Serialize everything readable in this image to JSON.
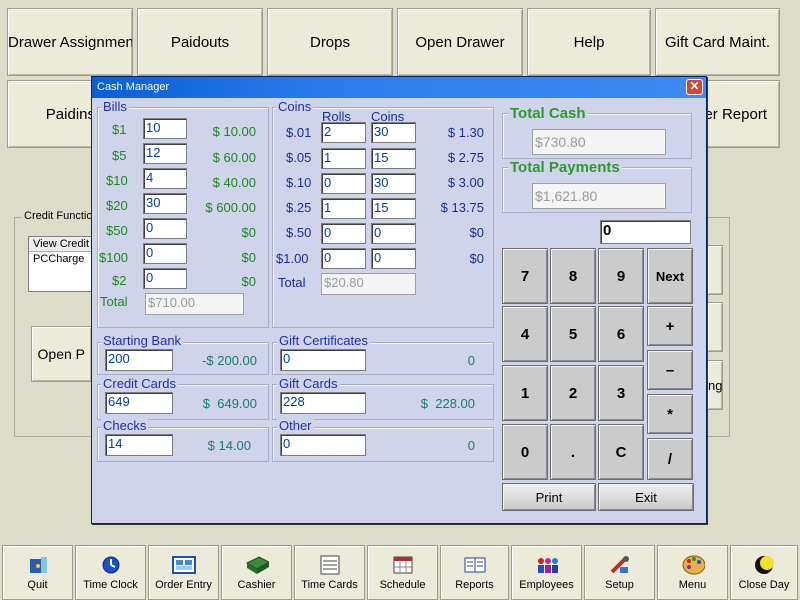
{
  "top_buttons": [
    "Drawer Assignment",
    "Paidouts",
    "Drops",
    "Open Drawer",
    "Help",
    "Gift Card Maint.",
    "Paidins",
    "er Report"
  ],
  "background": {
    "credit_functions_label": "Credit Function",
    "list_header": "View Credit S",
    "list_item": "PCCharge",
    "open_button": "Open P",
    "right_partial": "ng"
  },
  "dialog": {
    "title": "Cash Manager",
    "close_glyph": "✕",
    "bills": {
      "label": "Bills",
      "rows": [
        {
          "denom": "$1",
          "count": "10",
          "amount": "$ 10.00"
        },
        {
          "denom": "$5",
          "count": "12",
          "amount": "$ 60.00"
        },
        {
          "denom": "$10",
          "count": "4",
          "amount": "$ 40.00"
        },
        {
          "denom": "$20",
          "count": "30",
          "amount": "$ 600.00"
        },
        {
          "denom": "$50",
          "count": "0",
          "amount": "$0"
        },
        {
          "denom": "$100",
          "count": "0",
          "amount": "$0"
        },
        {
          "denom": "$2",
          "count": "0",
          "amount": "$0"
        }
      ],
      "total_label": "Total",
      "total_value": "$710.00"
    },
    "coins": {
      "label": "Coins",
      "rolls_header": "Rolls",
      "coins_header": "Coins",
      "rows": [
        {
          "denom": "$.01",
          "rolls": "2",
          "coins": "30",
          "amount": "$ 1.30"
        },
        {
          "denom": "$.05",
          "rolls": "1",
          "coins": "15",
          "amount": "$ 2.75"
        },
        {
          "denom": "$.10",
          "rolls": "0",
          "coins": "30",
          "amount": "$ 3.00"
        },
        {
          "denom": "$.25",
          "rolls": "1",
          "coins": "15",
          "amount": "$ 13.75"
        },
        {
          "denom": "$.50",
          "rolls": "0",
          "coins": "0",
          "amount": "$0"
        },
        {
          "denom": "$1.00",
          "rolls": "0",
          "coins": "0",
          "amount": "$0"
        }
      ],
      "total_label": "Total",
      "total_value": "$20.80"
    },
    "starting_bank": {
      "label": "Starting Bank",
      "value": "200",
      "amount": "-$ 200.00"
    },
    "credit_cards": {
      "label": "Credit Cards",
      "value": "649",
      "amount": "$  649.00"
    },
    "checks": {
      "label": "Checks",
      "value": "14",
      "amount": "$ 14.00"
    },
    "gift_certificates": {
      "label": "Gift Certificates",
      "value": "0",
      "amount": "0"
    },
    "gift_cards": {
      "label": "Gift Cards",
      "value": "228",
      "amount": "$  228.00"
    },
    "other": {
      "label": "Other",
      "value": "0",
      "amount": "0"
    },
    "total_cash": {
      "label": "Total Cash",
      "value": "$730.80"
    },
    "total_payments": {
      "label": "Total Payments",
      "value": "$1,621.80"
    },
    "display": "0",
    "keypad": [
      "7",
      "8",
      "9",
      "Next",
      "4",
      "5",
      "6",
      "+",
      "1",
      "2",
      "3",
      "–",
      "0",
      ".",
      "C",
      "*",
      "/"
    ],
    "print_label": "Print",
    "exit_label": "Exit"
  },
  "bottom_bar": [
    {
      "label": "Quit",
      "icon": "quit-icon"
    },
    {
      "label": "Time Clock",
      "icon": "time-clock-icon"
    },
    {
      "label": "Order Entry",
      "icon": "order-entry-icon"
    },
    {
      "label": "Cashier",
      "icon": "cashier-icon"
    },
    {
      "label": "Time Cards",
      "icon": "time-cards-icon"
    },
    {
      "label": "Schedule",
      "icon": "schedule-icon"
    },
    {
      "label": "Reports",
      "icon": "reports-icon"
    },
    {
      "label": "Employees",
      "icon": "employees-icon"
    },
    {
      "label": "Setup",
      "icon": "setup-icon"
    },
    {
      "label": "Menu",
      "icon": "menu-icon"
    },
    {
      "label": "Close Day",
      "icon": "close-day-icon"
    }
  ]
}
